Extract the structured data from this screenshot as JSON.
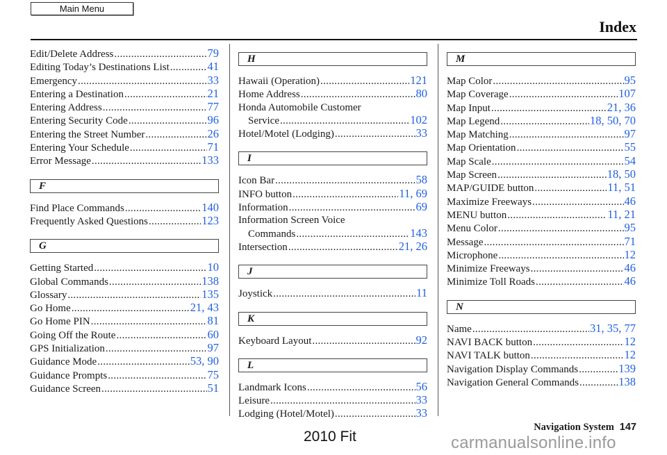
{
  "toolbar": {
    "main_menu_label": "Main Menu"
  },
  "header": {
    "title": "Index"
  },
  "colors": {
    "link": "#1f5fe0",
    "text": "#1a1a1a",
    "watermark": "#9a9a9a"
  },
  "columns": [
    {
      "sections": [
        {
          "letter": null,
          "entries": [
            {
              "term": "Edit/Delete Address",
              "pages": "79"
            },
            {
              "term": "Editing Today’s Destinations List",
              "pages": "41"
            },
            {
              "term": "Emergency",
              "pages": "33"
            },
            {
              "term": "Entering a Destination",
              "pages": "21"
            },
            {
              "term": "Entering Address",
              "pages": "77"
            },
            {
              "term": "Entering Security Code",
              "pages": "96"
            },
            {
              "term": "Entering the Street Number",
              "pages": "26"
            },
            {
              "term": "Entering Your Schedule",
              "pages": "71"
            },
            {
              "term": "Error Message",
              "pages": "133"
            }
          ]
        },
        {
          "letter": "F",
          "entries": [
            {
              "term": "Find Place Commands",
              "pages": "140"
            },
            {
              "term": "Frequently Asked Questions",
              "pages": "123"
            }
          ]
        },
        {
          "letter": "G",
          "entries": [
            {
              "term": "Getting Started",
              "pages": "10"
            },
            {
              "term": "Global Commands",
              "pages": "138"
            },
            {
              "term": "Glossary",
              "pages": "135"
            },
            {
              "term": "Go Home",
              "pages": "21, 43"
            },
            {
              "term": "Go Home PIN",
              "pages": "81"
            },
            {
              "term": "Going Off the Route",
              "pages": "60"
            },
            {
              "term": "GPS Initialization",
              "pages": "97"
            },
            {
              "term": "Guidance Mode",
              "pages": "53, 90"
            },
            {
              "term": "Guidance Prompts",
              "pages": "75"
            },
            {
              "term": "Guidance Screen",
              "pages": "51"
            }
          ]
        }
      ]
    },
    {
      "sections": [
        {
          "letter": "H",
          "entries": [
            {
              "term": "Hawaii (Operation)",
              "pages": "121"
            },
            {
              "term": "Home Address",
              "pages": "80"
            },
            {
              "term": "Honda Automobile Customer",
              "pages": null,
              "head": true
            },
            {
              "term": "Service",
              "pages": "102",
              "indent": true
            },
            {
              "term": "Hotel/Motel (Lodging)",
              "pages": "33"
            }
          ]
        },
        {
          "letter": "I",
          "entries": [
            {
              "term": "Icon Bar",
              "pages": "58"
            },
            {
              "term": "INFO button",
              "pages": "11, 69"
            },
            {
              "term": "Information",
              "pages": "69"
            },
            {
              "term": "Information Screen Voice",
              "pages": null,
              "head": true
            },
            {
              "term": "Commands",
              "pages": "143",
              "indent": true
            },
            {
              "term": "Intersection",
              "pages": "21, 26"
            }
          ]
        },
        {
          "letter": "J",
          "entries": [
            {
              "term": "Joystick",
              "pages": "11"
            }
          ]
        },
        {
          "letter": "K",
          "entries": [
            {
              "term": "Keyboard Layout",
              "pages": "92"
            }
          ]
        },
        {
          "letter": "L",
          "entries": [
            {
              "term": "Landmark Icons",
              "pages": "56"
            },
            {
              "term": "Leisure",
              "pages": "33"
            },
            {
              "term": "Lodging (Hotel/Motel)",
              "pages": "33"
            }
          ]
        }
      ]
    },
    {
      "sections": [
        {
          "letter": "M",
          "entries": [
            {
              "term": "Map Color",
              "pages": "95"
            },
            {
              "term": "Map Coverage",
              "pages": "107"
            },
            {
              "term": "Map Input",
              "pages": "21, 36"
            },
            {
              "term": "Map Legend",
              "pages": "18, 50, 70"
            },
            {
              "term": "Map Matching",
              "pages": "97"
            },
            {
              "term": "Map Orientation",
              "pages": "55"
            },
            {
              "term": "Map Scale",
              "pages": "54"
            },
            {
              "term": "Map Screen",
              "pages": "18, 50"
            },
            {
              "term": "MAP/GUIDE button",
              "pages": "11, 51"
            },
            {
              "term": "Maximize Freeways",
              "pages": "46"
            },
            {
              "term": "MENU button",
              "pages": "11, 21"
            },
            {
              "term": "Menu Color",
              "pages": "95"
            },
            {
              "term": "Message",
              "pages": "71"
            },
            {
              "term": "Microphone",
              "pages": "12"
            },
            {
              "term": "Minimize Freeways",
              "pages": "46"
            },
            {
              "term": "Minimize Toll Roads",
              "pages": "46"
            }
          ]
        },
        {
          "letter": "N",
          "entries": [
            {
              "term": "Name",
              "pages": "31, 35, 77"
            },
            {
              "term": "NAVI BACK button",
              "pages": "12"
            },
            {
              "term": "NAVI TALK button",
              "pages": "12"
            },
            {
              "term": "Navigation Display Commands",
              "pages": "139"
            },
            {
              "term": "Navigation General Commands",
              "pages": "138"
            }
          ]
        }
      ]
    }
  ],
  "footer": {
    "section_name": "Navigation System",
    "page_number": "147",
    "model": "2010 Fit",
    "watermark": "carmanualsonline.info"
  }
}
